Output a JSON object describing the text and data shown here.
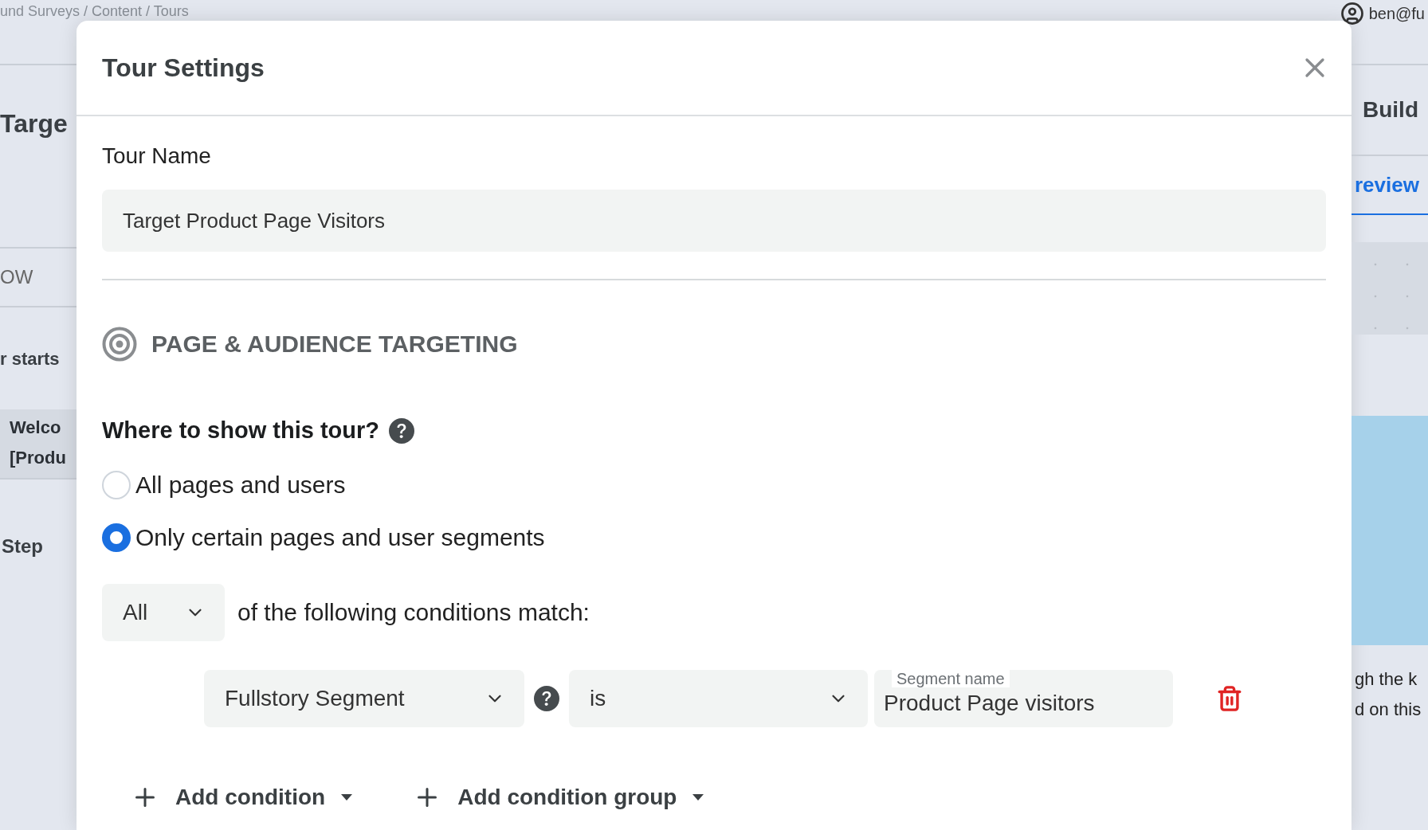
{
  "background": {
    "breadcrumb": "und Surveys / Content / Tours",
    "user_email": "ben@fu",
    "left_panel": {
      "title": "Targe",
      "tab": "OW",
      "heading": "r starts",
      "item_lines": [
        "Welco",
        "[Produ"
      ],
      "step": "Step"
    },
    "right_panel": {
      "tabs": [
        {
          "label": "Build",
          "selected": false
        },
        {
          "label": "review",
          "selected": true
        }
      ],
      "text_lines": [
        "gh the k",
        "d on this"
      ]
    }
  },
  "modal": {
    "title": "Tour Settings",
    "tour_name": {
      "label": "Tour Name",
      "value": "Target Product Page Visitors"
    },
    "section": {
      "title": "PAGE & AUDIENCE TARGETING"
    },
    "where": {
      "question": "Where to show this tour?",
      "options": [
        {
          "label": "All pages and users",
          "selected": false
        },
        {
          "label": "Only certain pages and user segments",
          "selected": true
        }
      ]
    },
    "match": {
      "mode": "All",
      "suffix": "of the following conditions match:"
    },
    "conditions": [
      {
        "field": "Fullstory Segment",
        "operator": "is",
        "value_label": "Segment name",
        "value": "Product Page visitors"
      }
    ],
    "actions": [
      {
        "label": "Add condition"
      },
      {
        "label": "Add condition group"
      }
    ]
  }
}
